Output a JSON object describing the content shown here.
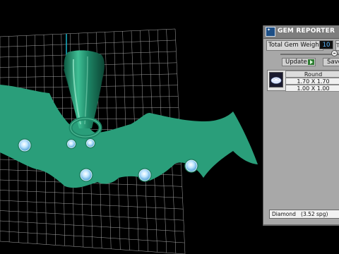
{
  "panel": {
    "title": "GEM REPORTER",
    "app_icon_text": "✦",
    "weight_label": "Total Gem Weight",
    "weight_value": "10",
    "weight_spin": "T",
    "update_label": "Update",
    "save_label": "Save",
    "gem": {
      "shape": "Round",
      "size1": "1.70 X 1.70",
      "size2": "1.00 X 1.00"
    },
    "material": "Diamond   (3.52 spg)"
  },
  "viewport": {
    "model_color": "#2a9e7a",
    "grid_color": "#ffffff",
    "axis_color": "#19b3c8",
    "gem_color": "#7ec6ee",
    "gem_count": 7
  }
}
